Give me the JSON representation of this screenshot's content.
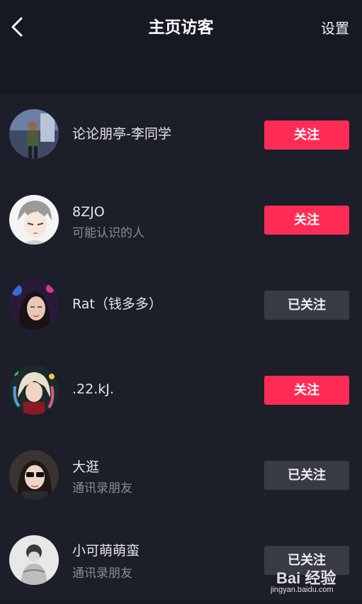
{
  "header": {
    "title": "主页访客",
    "settings_label": "设置",
    "back_icon": "chevron-left-icon"
  },
  "visitors": [
    {
      "name": "论论朋亭-李同学",
      "subtitle": "",
      "button": "关注",
      "button_state": "follow",
      "avatar": "avatar-icon"
    },
    {
      "name": "8ZJO",
      "subtitle": "可能认识的人",
      "button": "关注",
      "button_state": "follow",
      "avatar": "avatar-icon"
    },
    {
      "name": "Rat（钱多多）",
      "subtitle": "",
      "button": "已关注",
      "button_state": "followed",
      "avatar": "avatar-icon"
    },
    {
      "name": ".22.kJ.",
      "subtitle": "",
      "button": "关注",
      "button_state": "follow",
      "avatar": "avatar-icon"
    },
    {
      "name": "大逛",
      "subtitle": "通讯录朋友",
      "button": "已关注",
      "button_state": "followed",
      "avatar": "avatar-icon"
    },
    {
      "name": "小可萌萌蛮",
      "subtitle": "通讯录朋友",
      "button": "已关注",
      "button_state": "followed",
      "avatar": "avatar-icon"
    }
  ],
  "watermark": {
    "logo": "Bai 经验",
    "url": "jingyan.baidu.com"
  },
  "colors": {
    "background": "#161823",
    "list_background": "#1c1e29",
    "follow_button": "#fe2c55",
    "followed_button": "#393b44",
    "subtitle_text": "#8a8b93"
  }
}
